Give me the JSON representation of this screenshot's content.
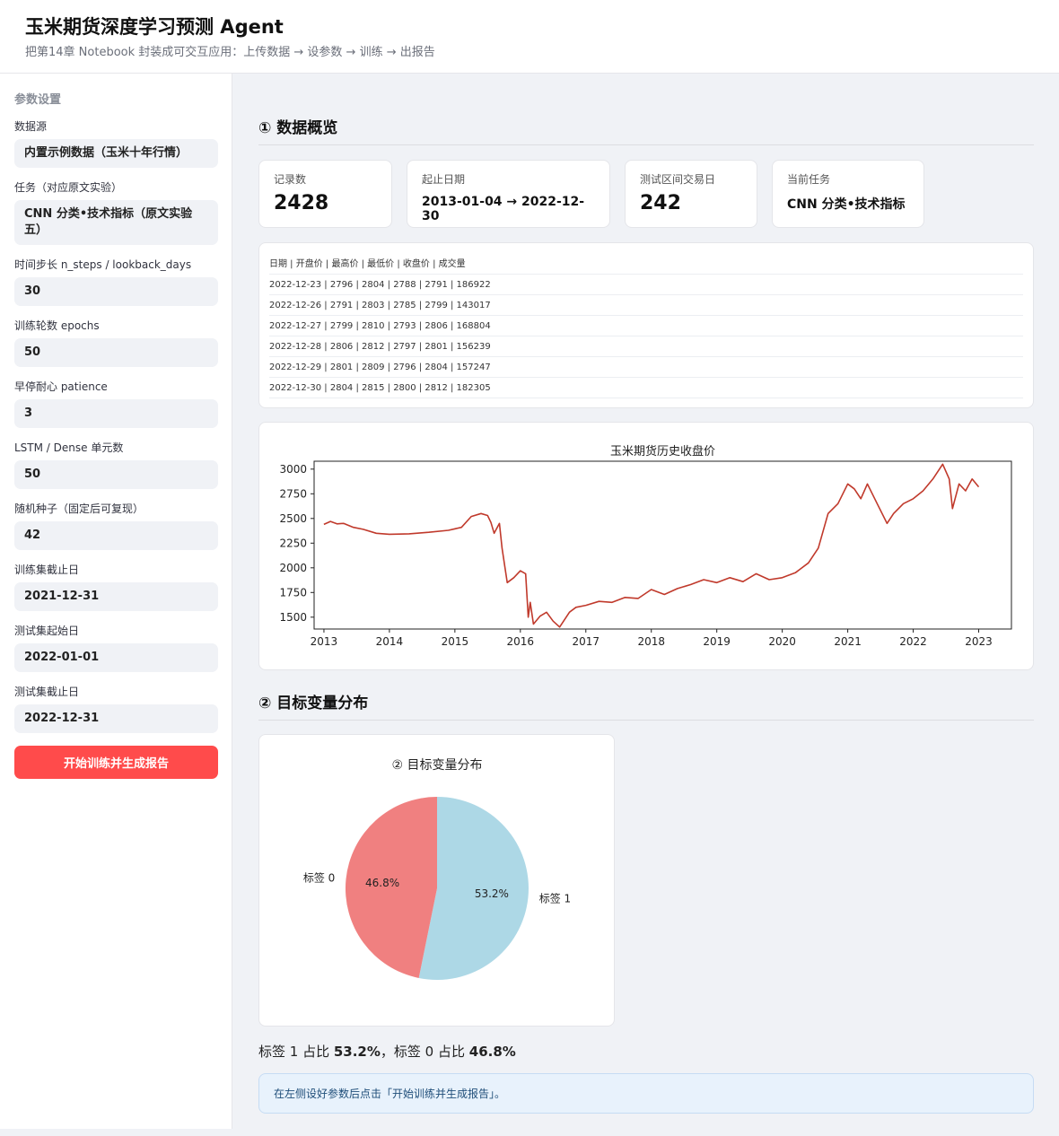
{
  "app": {
    "title": "玉米期货深度学习预测 Agent",
    "subtitle": "把第14章 Notebook 封装成可交互应用：上传数据 → 设参数 → 训练 → 出报告"
  },
  "sidebar": {
    "heading": "参数设置",
    "fields": [
      {
        "label": "数据源",
        "value": "内置示例数据（玉米十年行情）"
      },
      {
        "label": "任务（对应原文实验）",
        "value": "CNN 分类•技术指标（原文实验五）"
      },
      {
        "label": "时间步长 n_steps / lookback_days",
        "value": "30"
      },
      {
        "label": "训练轮数 epochs",
        "value": "50"
      },
      {
        "label": "早停耐心 patience",
        "value": "3"
      },
      {
        "label": "LSTM / Dense 单元数",
        "value": "50"
      },
      {
        "label": "随机种子（固定后可复现）",
        "value": "42"
      },
      {
        "label": "训练集截止日",
        "value": "2021-12-31"
      },
      {
        "label": "测试集起始日",
        "value": "2022-01-01"
      },
      {
        "label": "测试集截止日",
        "value": "2022-12-31"
      }
    ],
    "run_label": "开始训练并生成报告"
  },
  "main": {
    "section1_title": "① 数据概览",
    "metrics": [
      {
        "label": "记录数",
        "value": "2428"
      },
      {
        "label": "起止日期",
        "value": "2013-01-04 → 2022-12-30"
      },
      {
        "label": "测试区间交易日",
        "value": "242"
      },
      {
        "label": "当前任务",
        "value": "CNN 分类•技术指标"
      }
    ],
    "table": {
      "header": "日期 | 开盘价 | 最高价 | 最低价 | 收盘价 | 成交量",
      "rows": [
        "2022-12-23 | 2796 | 2804 | 2788 | 2791 | 186922",
        "2022-12-26 | 2791 | 2803 | 2785 | 2799 | 143017",
        "2022-12-27 | 2799 | 2810 | 2793 | 2806 | 168804",
        "2022-12-28 | 2806 | 2812 | 2797 | 2801 | 156239",
        "2022-12-29 | 2801 | 2809 | 2796 | 2804 | 157247",
        "2022-12-30 | 2804 | 2815 | 2800 | 2812 | 182305"
      ]
    },
    "section2_title": "② 目标变量分布",
    "summary": {
      "prefix1": "标签 1 占比 ",
      "pct1": "53.2%",
      "mid": "，标签 0 占比 ",
      "pct0": "46.8%"
    },
    "info": "在左侧设好参数后点击「开始训练并生成报告」。"
  },
  "chart_data": [
    {
      "type": "line",
      "title": "玉米期货历史收盘价",
      "xlabel": "",
      "ylabel": "",
      "xlim": [
        2012.85,
        2023.5
      ],
      "ylim": [
        1380,
        3080
      ],
      "xticks": [
        2013,
        2014,
        2015,
        2016,
        2017,
        2018,
        2019,
        2020,
        2021,
        2022,
        2023
      ],
      "yticks": [
        1500,
        1750,
        2000,
        2250,
        2500,
        2750,
        3000
      ],
      "color": "#c0392b",
      "grid": false,
      "series": [
        {
          "x": [
            2013.0,
            2013.1,
            2013.2,
            2013.3,
            2013.45,
            2013.6,
            2013.8,
            2014.0,
            2014.3,
            2014.6,
            2014.9,
            2015.1,
            2015.25,
            2015.4,
            2015.5,
            2015.55,
            2015.6,
            2015.68,
            2015.72,
            2015.8,
            2015.9,
            2016.0,
            2016.08,
            2016.12,
            2016.15,
            2016.2,
            2016.3,
            2016.4,
            2016.5,
            2016.6,
            2016.75,
            2016.85,
            2017.0,
            2017.2,
            2017.4,
            2017.6,
            2017.8,
            2018.0,
            2018.2,
            2018.4,
            2018.6,
            2018.8,
            2019.0,
            2019.2,
            2019.4,
            2019.6,
            2019.8,
            2020.0,
            2020.2,
            2020.4,
            2020.55,
            2020.7,
            2020.85,
            2021.0,
            2021.1,
            2021.2,
            2021.3,
            2021.45,
            2021.6,
            2021.7,
            2021.85,
            2022.0,
            2022.15,
            2022.3,
            2022.45,
            2022.55,
            2022.6,
            2022.7,
            2022.8,
            2022.9,
            2023.0
          ],
          "y": [
            2440,
            2470,
            2445,
            2450,
            2410,
            2390,
            2350,
            2340,
            2345,
            2360,
            2380,
            2410,
            2520,
            2550,
            2530,
            2460,
            2350,
            2450,
            2200,
            1850,
            1900,
            1970,
            1940,
            1500,
            1650,
            1430,
            1510,
            1550,
            1460,
            1400,
            1550,
            1600,
            1620,
            1660,
            1650,
            1700,
            1690,
            1780,
            1730,
            1790,
            1830,
            1880,
            1850,
            1900,
            1860,
            1940,
            1880,
            1900,
            1950,
            2050,
            2200,
            2550,
            2650,
            2850,
            2800,
            2700,
            2850,
            2650,
            2450,
            2550,
            2650,
            2700,
            2780,
            2900,
            3050,
            2900,
            2600,
            2850,
            2780,
            2900,
            2820
          ]
        }
      ]
    },
    {
      "type": "pie",
      "title": "② 目标变量分布",
      "labels": [
        "标签 1",
        "标签 0"
      ],
      "values": [
        53.2,
        46.8
      ],
      "colors": [
        "#add8e6",
        "#f08080"
      ],
      "value_labels": [
        "53.2%",
        "46.8%"
      ],
      "start": "top",
      "direction": "clockwise"
    }
  ]
}
